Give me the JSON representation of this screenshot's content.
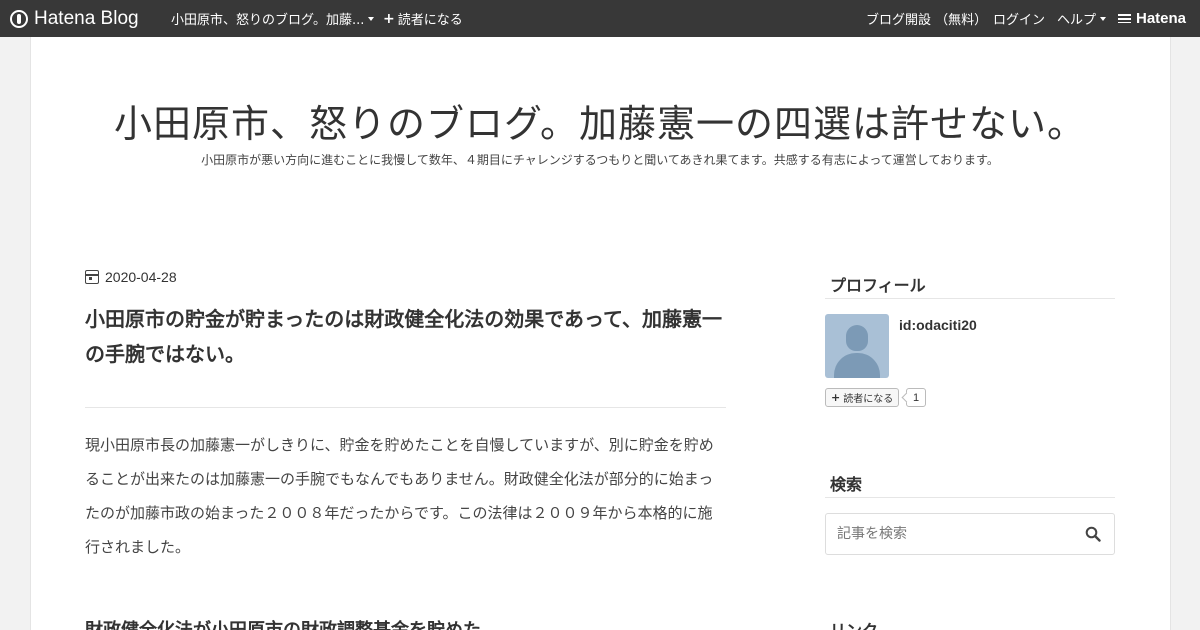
{
  "topbar": {
    "brand": "Hatena Blog",
    "blog_menu": "小田原市、怒りのブログ。加藤...",
    "subscribe": "読者になる",
    "open_blog": "ブログ開設 （無料）",
    "login": "ログイン",
    "help": "ヘルプ",
    "hatena": "Hatena"
  },
  "blog": {
    "title": "小田原市、怒りのブログ。加藤憲一の四選は許せない。",
    "description": "小田原市が悪い方向に進むことに我慢して数年、４期目にチャレンジするつもりと聞いてあきれ果てます。共感する有志によって運営しております。"
  },
  "entry": {
    "date": "2020-04-28",
    "title": "小田原市の貯金が貯まったのは財政健全化法の効果であって、加藤憲一の手腕ではない。",
    "body": "現小田原市長の加藤憲一がしきりに、貯金を貯めたことを自慢していますが、別に貯金を貯めることが出来たのは加藤憲一の手腕でもなんでもありません。財政健全化法が部分的に始まったのが加藤市政の始まった２００８年だったからです。この法律は２００９年から本格的に施行されました。",
    "heading2": "財政健全化法が小田原市の財政調整基金を貯めた"
  },
  "sidebar": {
    "profile_heading": "プロフィール",
    "profile_id": "id:odaciti20",
    "subscribe_label": "読者になる",
    "subscriber_count": "1",
    "search_heading": "検索",
    "search_placeholder": "記事を検索",
    "links_heading": "リンク"
  },
  "icons": {
    "logo": "hatena-blog-logo-icon",
    "date": "calendar-icon",
    "search": "search-icon",
    "avatar": "default-avatar-icon"
  },
  "colors": {
    "topbar_bg": "#383838",
    "page_bg": "#f2f2f2",
    "content_bg": "#ffffff",
    "avatar_bg": "#a9c0d6"
  }
}
